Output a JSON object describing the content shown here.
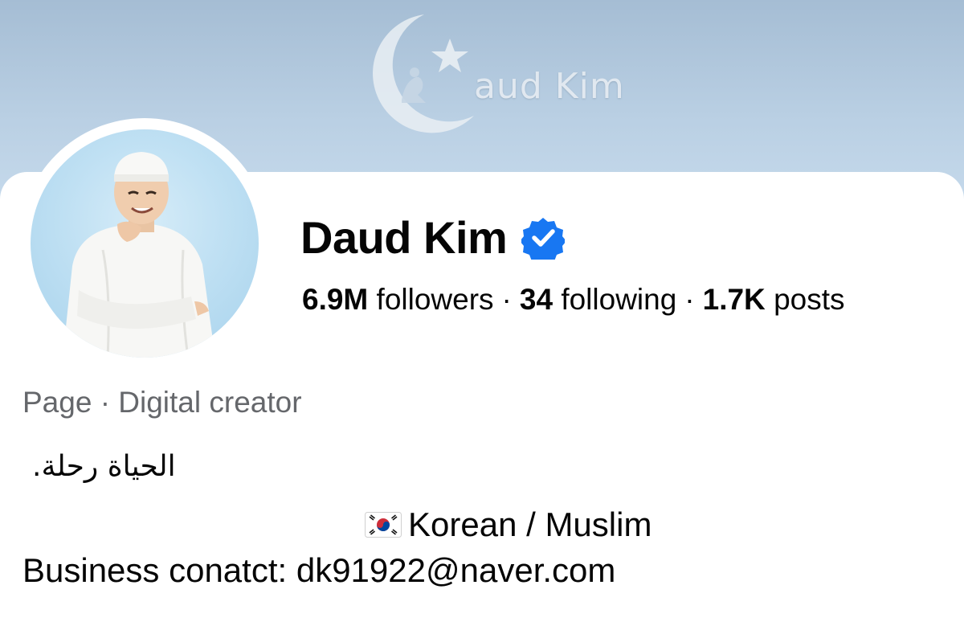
{
  "cover": {
    "logo_text": "aud Kim"
  },
  "profile": {
    "name": "Daud Kim",
    "verified": true,
    "stats": {
      "followers_value": "6.9M",
      "followers_label": "followers",
      "following_value": "34",
      "following_label": "following",
      "posts_value": "1.7K",
      "posts_label": "posts",
      "separator": "·"
    },
    "category": "Page · Digital creator",
    "bio": {
      "line1": "الحياة رحلة.",
      "line2": "Korean / Muslim",
      "line3": "Business conatct: dk91922@naver.com"
    }
  },
  "icons": {
    "verified": "verified-badge-icon",
    "flag": "south-korea-flag-icon",
    "cover_logo": "crescent-star-logo"
  },
  "colors": {
    "verified_blue": "#1877f2",
    "secondary_text": "#65676b",
    "cover_top": "#a5bdd4",
    "cover_bottom": "#c6daec"
  }
}
